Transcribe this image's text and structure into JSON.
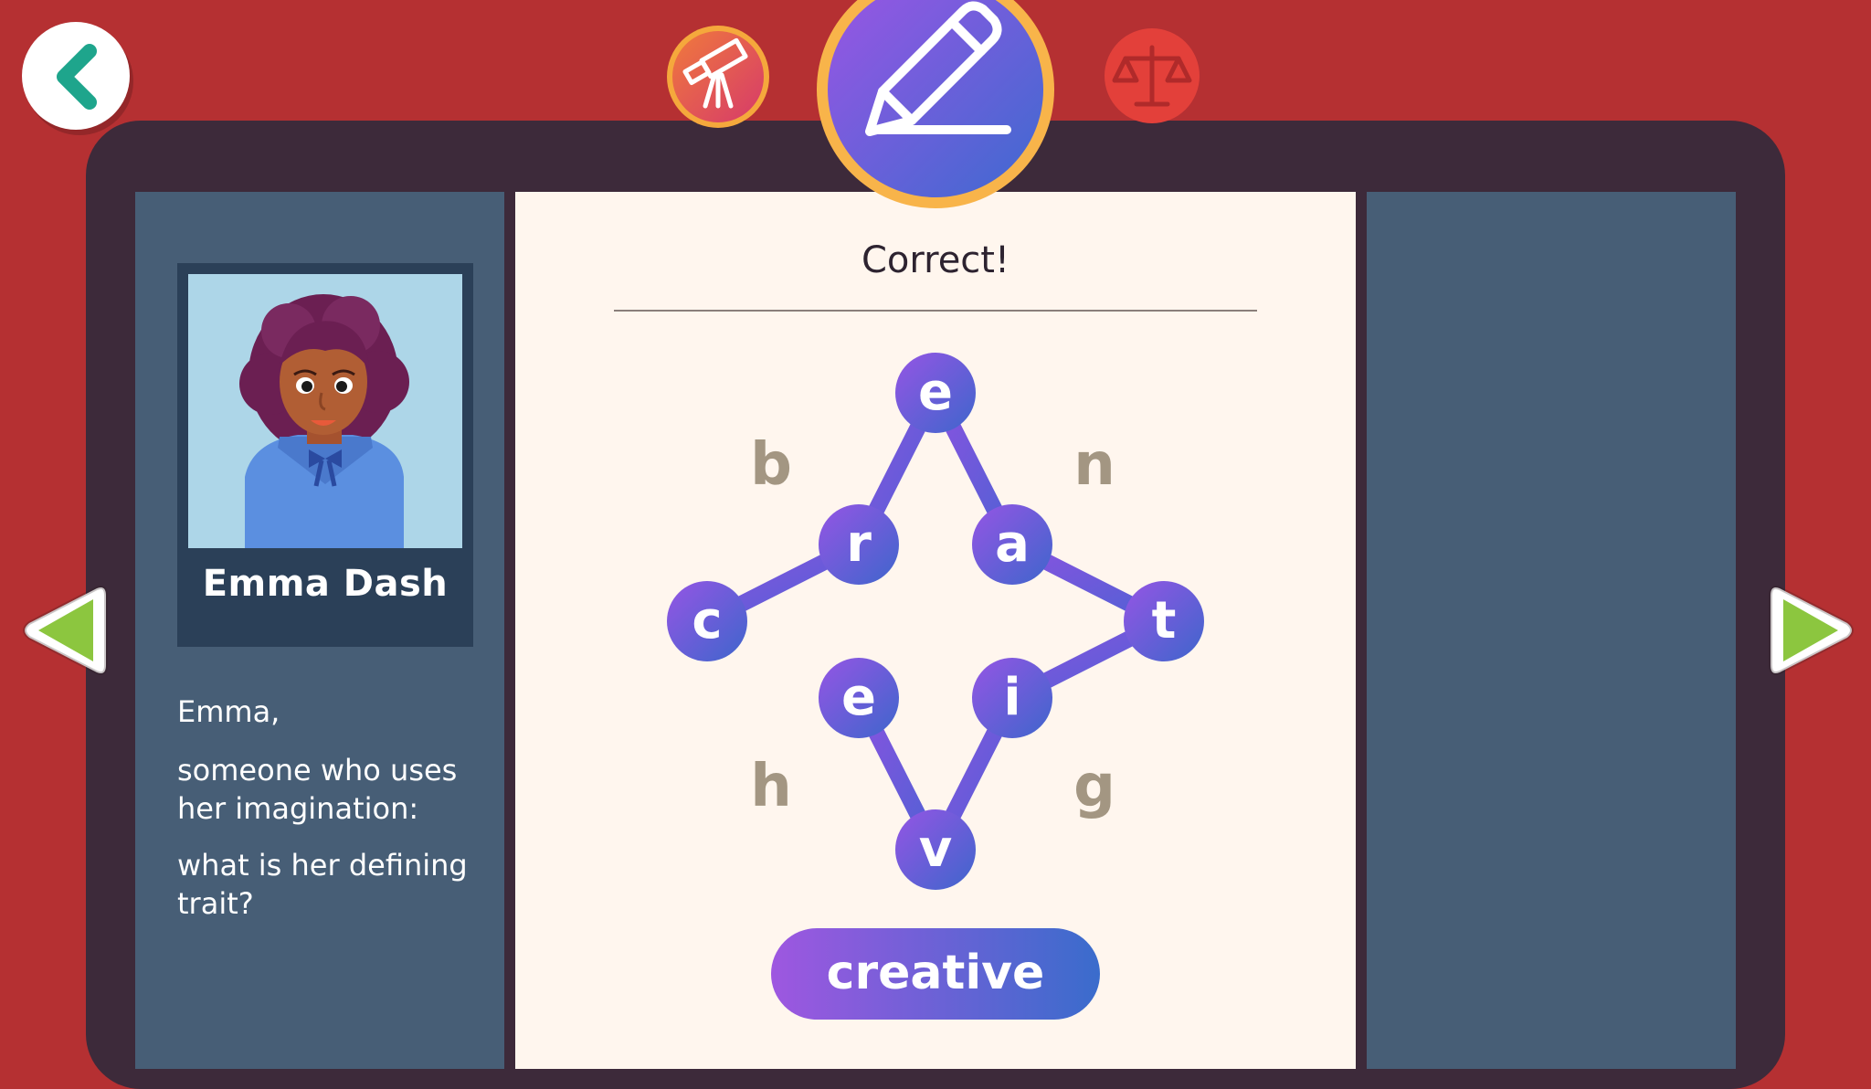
{
  "character": {
    "name": "Emma Dash",
    "prompt_line1": "Emma,",
    "prompt_line2": "someone who uses her imagination:",
    "prompt_line3": "what is her defining trait?"
  },
  "puzzle": {
    "result_text": "Correct!",
    "selected_letters": [
      "c",
      "r",
      "e",
      "a",
      "t",
      "i",
      "v",
      "e"
    ],
    "unused_letters": [
      "b",
      "n",
      "h",
      "g"
    ],
    "answer": "creative"
  },
  "icons": {
    "back": "back-chevron-icon",
    "telescope": "telescope-icon",
    "pencil": "pencil-icon",
    "scales": "scales-icon",
    "prev": "left-arrow-icon",
    "next": "right-arrow-icon"
  },
  "colors": {
    "background": "#b53032",
    "frame": "#3d2a3a",
    "panel": "#475e76",
    "page": "#fff6ee",
    "node_purple": "#8a4fe0",
    "node_blue": "#4a62d0",
    "arrow_green": "#8cc63f",
    "unused_letter": "#a39682"
  }
}
